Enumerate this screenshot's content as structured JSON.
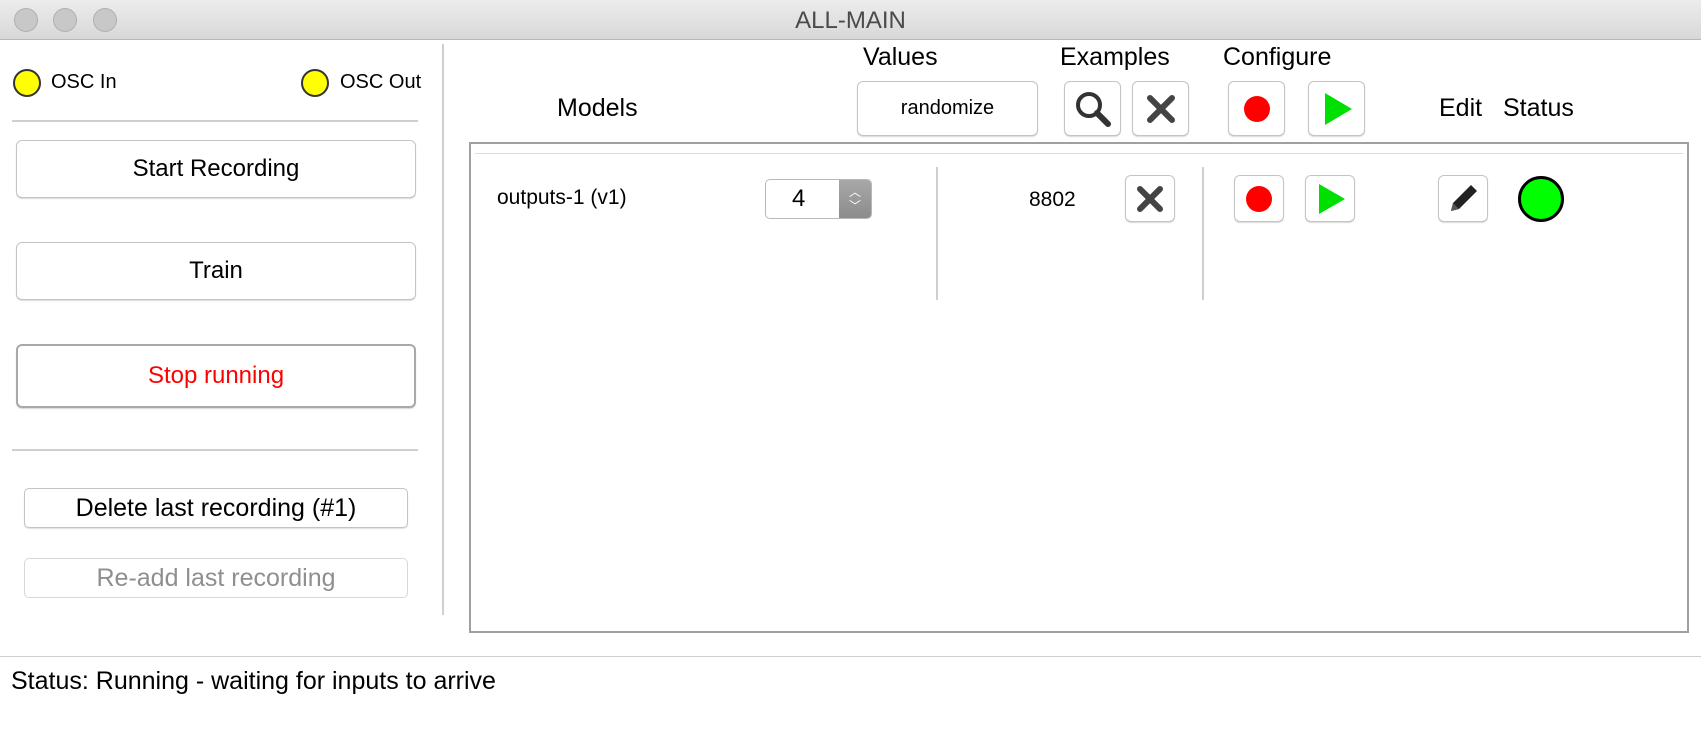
{
  "window": {
    "title": "ALL-MAIN"
  },
  "osc": {
    "in_label": "OSC In",
    "out_label": "OSC Out",
    "led_color": "#ffff00"
  },
  "left_panel": {
    "start_recording": "Start Recording",
    "train": "Train",
    "stop_running": "Stop running",
    "delete_last": "Delete last recording (#1)",
    "readd_last": "Re-add last recording"
  },
  "headers": {
    "models": "Models",
    "values": "Values",
    "examples": "Examples",
    "configure": "Configure",
    "edit": "Edit",
    "status": "Status"
  },
  "toolbar": {
    "randomize": "randomize",
    "icons": [
      "search-icon",
      "close-icon",
      "record-icon",
      "play-icon"
    ]
  },
  "models": [
    {
      "name": "outputs-1 (v1)",
      "value": "4",
      "examples_count": "8802",
      "status_color": "#00ff00",
      "icons": [
        "close-icon",
        "record-icon",
        "play-icon",
        "edit-pencil-icon",
        "status-indicator"
      ]
    }
  ],
  "colors": {
    "record": "#ff0000",
    "play": "#00e000",
    "stop_text": "#ff0000"
  },
  "status_bar": {
    "text": "Status:  Running - waiting for inputs to arrive"
  }
}
